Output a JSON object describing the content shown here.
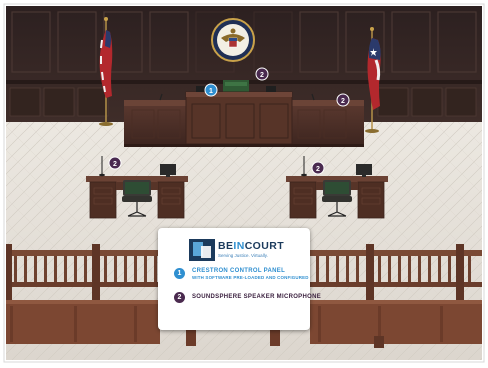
{
  "brand": {
    "name_part1": "BE",
    "name_part2": "IN",
    "name_part3": "COURT",
    "tagline": "Serving Justice. Virtually."
  },
  "legend": {
    "items": [
      {
        "number": "1",
        "title": "CRESTRON CONTROL PANEL",
        "subtitle": "WITH SOFTWARE PRE-LOADED AND CONFIGURED",
        "color": "#2f8fd0"
      },
      {
        "number": "2",
        "title": "SOUNDSPHERE SPEAKER MICROPHONE",
        "subtitle": "",
        "color": "#4a2a4f"
      }
    ]
  },
  "markers": [
    {
      "number": "1",
      "color": "#2f8fd0"
    },
    {
      "number": "2",
      "color": "#4a2a4f"
    },
    {
      "number": "2",
      "color": "#4a2a4f"
    },
    {
      "number": "2",
      "color": "#4a2a4f"
    },
    {
      "number": "2",
      "color": "#4a2a4f"
    }
  ],
  "colors": {
    "wall": "#3b2b28",
    "wood": "#5a3224",
    "floor": "#e6e1da"
  }
}
